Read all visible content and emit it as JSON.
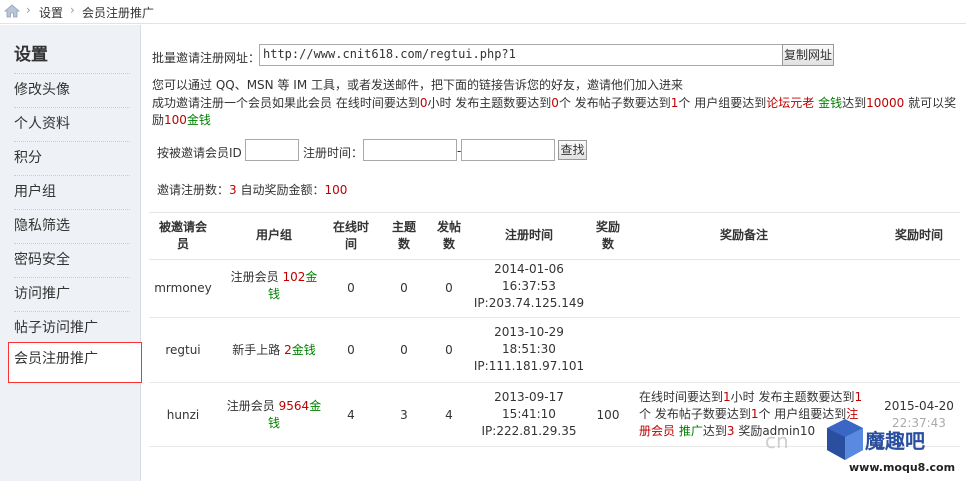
{
  "breadcrumb": {
    "items": [
      "设置",
      "会员注册推广"
    ]
  },
  "sidebar": {
    "title": "设置",
    "items": [
      {
        "label": "修改头像"
      },
      {
        "label": "个人资料"
      },
      {
        "label": "积分"
      },
      {
        "label": "用户组"
      },
      {
        "label": "隐私筛选"
      },
      {
        "label": "密码安全"
      },
      {
        "label": "访问推广"
      },
      {
        "label": "帖子访问推广"
      },
      {
        "label": "会员注册推广"
      }
    ]
  },
  "invite": {
    "label": "批量邀请注册网址：",
    "url": "http://www.cnit618.com/regtui.php?1",
    "copy_button": "复制网址",
    "hint": "您可以通过 QQ、MSN 等 IM 工具，或者发送邮件，把下面的链接告诉您的好友，邀请他们加入进来",
    "rule_parts": [
      "成功邀请注册一个会员如果此会员 在线时间要达到",
      "0",
      "小时 发布主题数要达到",
      "0",
      "个 发布帖子数要达到",
      "1",
      "个 用户组要达到",
      "论坛元老",
      " ",
      "金钱",
      "达到",
      "10000",
      " 就可以奖"
    ],
    "rule_line2": [
      "励",
      "100",
      "金钱"
    ]
  },
  "search": {
    "id_label": "按被邀请会员ID",
    "time_label": "注册时间：",
    "dash": "-",
    "button": "查找"
  },
  "stats": {
    "count_label": "邀请注册数：",
    "count": "3",
    "reward_label": " 自动奖励金额：",
    "reward": "100"
  },
  "table": {
    "headers": [
      [
        "被邀请会",
        "员"
      ],
      [
        "用户组"
      ],
      [
        "在线时",
        "间"
      ],
      [
        "主题",
        "数"
      ],
      [
        "发帖",
        "数"
      ],
      [
        "注册时间"
      ],
      [
        "奖励",
        "数"
      ],
      [
        "奖励备注"
      ],
      [
        "奖励时间"
      ]
    ],
    "rows": [
      {
        "member": "mrmoney",
        "group": "注册会员",
        "money": "102",
        "money_unit1": "金",
        "money_unit2": "钱",
        "online": "0",
        "threads": "0",
        "posts": "0",
        "reg_date": "2014-01-06",
        "reg_time": "16:37:53",
        "reg_ip": "IP:203.74.125.149",
        "reward": "",
        "note": "",
        "reward_time": ""
      },
      {
        "member": "regtui",
        "group": "新手上路",
        "money": "2",
        "money_unit1": "金钱",
        "money_unit2": "",
        "online": "0",
        "threads": "0",
        "posts": "0",
        "reg_date": "2013-10-29",
        "reg_time": "18:51:30",
        "reg_ip": "IP:111.181.97.101",
        "reward": "",
        "note": "",
        "reward_time": ""
      },
      {
        "member": "hunzi",
        "group": "注册会员",
        "money": "9564",
        "money_unit1": "金",
        "money_unit2": "钱",
        "online": "4",
        "threads": "3",
        "posts": "4",
        "reg_date": "2013-09-17",
        "reg_time": "15:41:10",
        "reg_ip": "IP:222.81.29.35",
        "reward": "100",
        "note_l1a": "在线时间要达到",
        "note_l1b": "1",
        "note_l1c": "小时 发布主题数要达到",
        "note_l1d": "1",
        "note_l2a": "个 发布帖子数要达到",
        "note_l2b": "1",
        "note_l2c": "个 用户组要达到",
        "note_l2d": "注",
        "note_l3a": "册会员",
        "note_l3b": " 推广",
        "note_l3c": "达到",
        "note_l3d": "3",
        "note_l3e": " 奖励admin10",
        "reward_date": "2015-04-20",
        "reward_clock": "22:37:43"
      }
    ]
  },
  "watermark": {
    "brand": "魔趣吧",
    "site": "www.moqu8.com"
  },
  "colors": {
    "red": "#c00000",
    "green": "#008000",
    "sidebar_bg": "#eef1f5"
  }
}
